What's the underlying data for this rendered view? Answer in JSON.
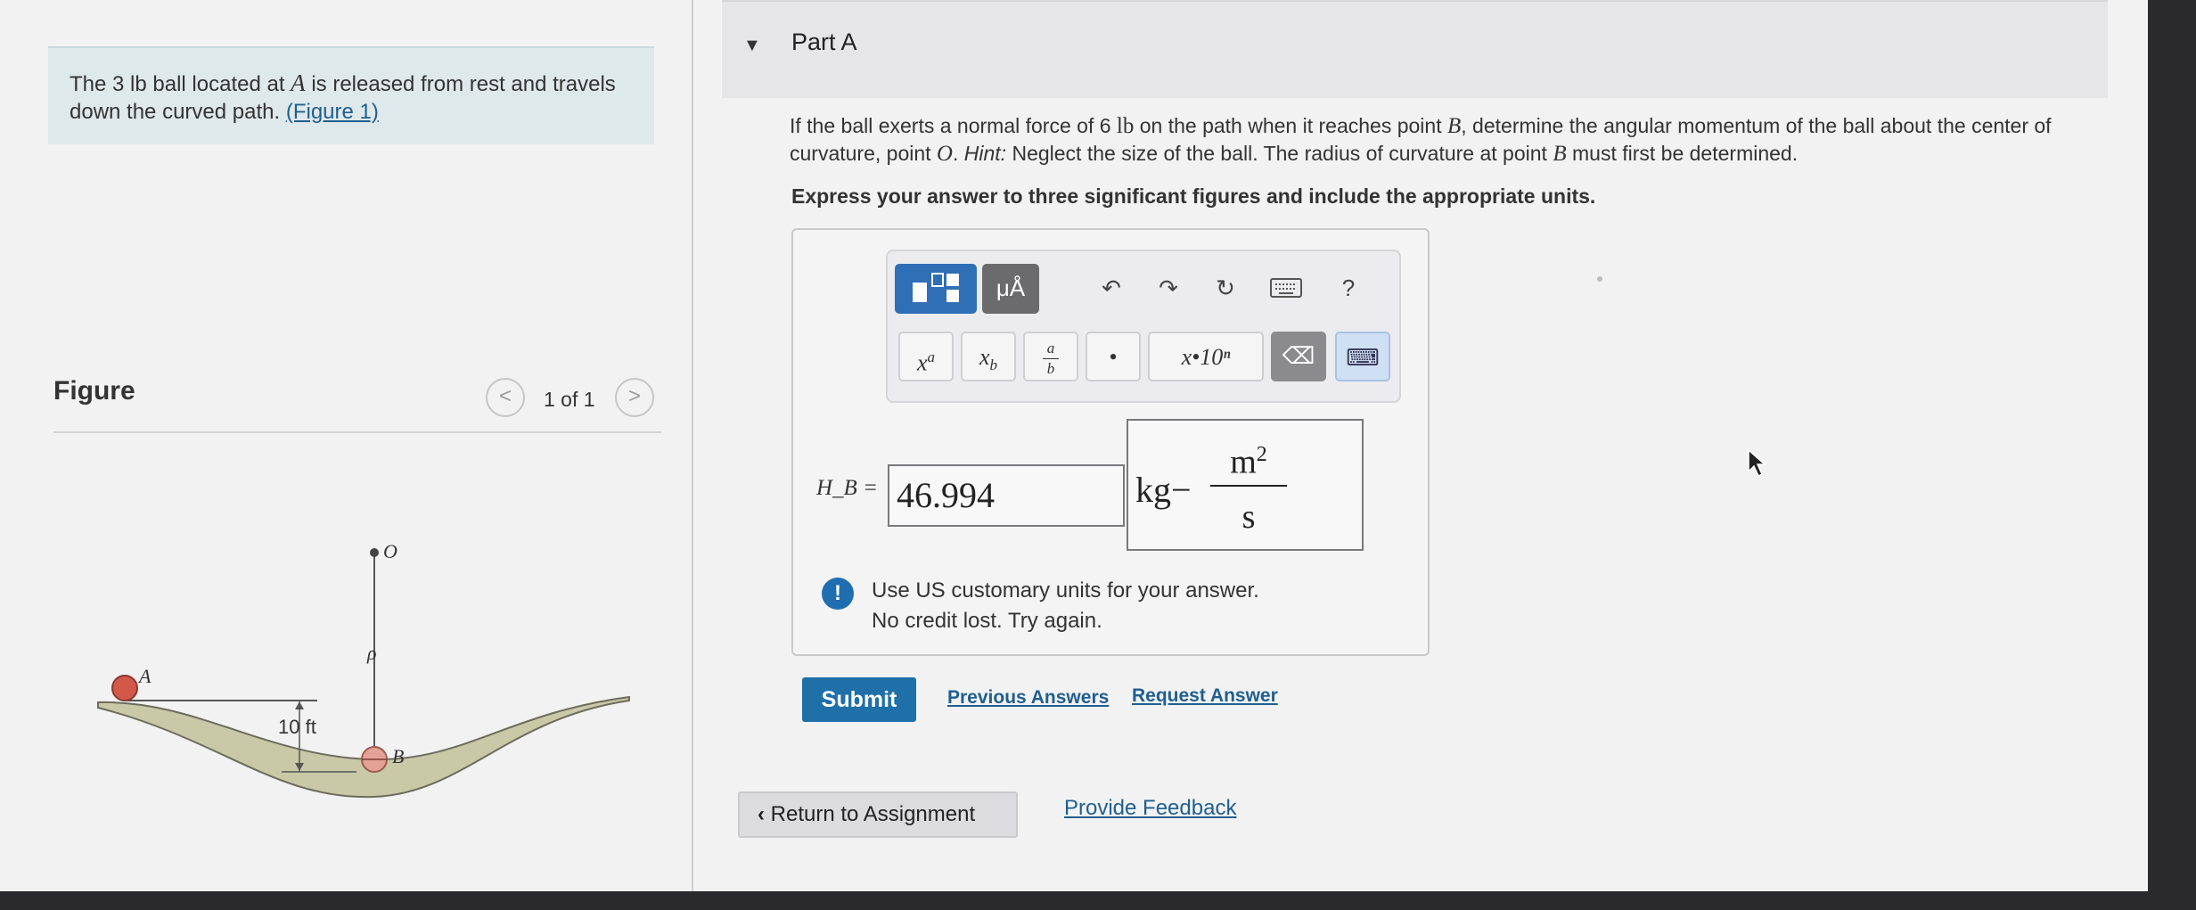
{
  "prompt": {
    "text_before": "The 3 lb ball located at ",
    "point_a": "A",
    "text_after": " is released from rest and travels down the curved path. ",
    "figure_link": "(Figure 1)"
  },
  "figure": {
    "title": "Figure",
    "counter": "1 of 1",
    "prev": "<",
    "next": ">",
    "labels": {
      "o": "O",
      "a": "A",
      "rho": "ρ",
      "height": "10 ft",
      "b": "B"
    }
  },
  "part": {
    "title": "Part A",
    "question_p1": "If the ball exerts a normal force of 6 ",
    "unit_lb": "lb",
    "question_p2": " on the path when it reaches point ",
    "point_b": "B",
    "question_p3": ", determine the angular momentum of the ball about the center of curvature, point ",
    "point_o": "O",
    "question_p4": ". ",
    "hint_label": "Hint:",
    "question_p5": " Neglect the size of the ball. The radius of curvature at point ",
    "point_b2": "B",
    "question_p6": " must first be determined.",
    "instruction": "Express your answer to three significant figures and include the appropriate units."
  },
  "toolbar": {
    "units_btn": "μÅ",
    "help": "?",
    "superscript": "xᵃ",
    "subscript": "x_b",
    "fraction_num": "a",
    "fraction_den": "b",
    "dot": "•",
    "sci": "x•10ⁿ"
  },
  "answer": {
    "label": "H_B =",
    "value": "46.994",
    "unit_kg": "kg−",
    "unit_num": "m",
    "unit_exp": "2",
    "unit_den": "s"
  },
  "feedback": {
    "icon": "!",
    "line1": "Use US customary units for your answer.",
    "line2": "No credit lost. Try again."
  },
  "actions": {
    "submit": "Submit",
    "previous_answers": "Previous Answers",
    "request_answer": "Request Answer",
    "return": "Return to Assignment",
    "provide_feedback": "Provide Feedback"
  },
  "colors": {
    "accent": "#1f6fa8",
    "prompt_bg": "#dfe8ea",
    "ball": "#d2584a",
    "ground": "#c9c9a8"
  }
}
